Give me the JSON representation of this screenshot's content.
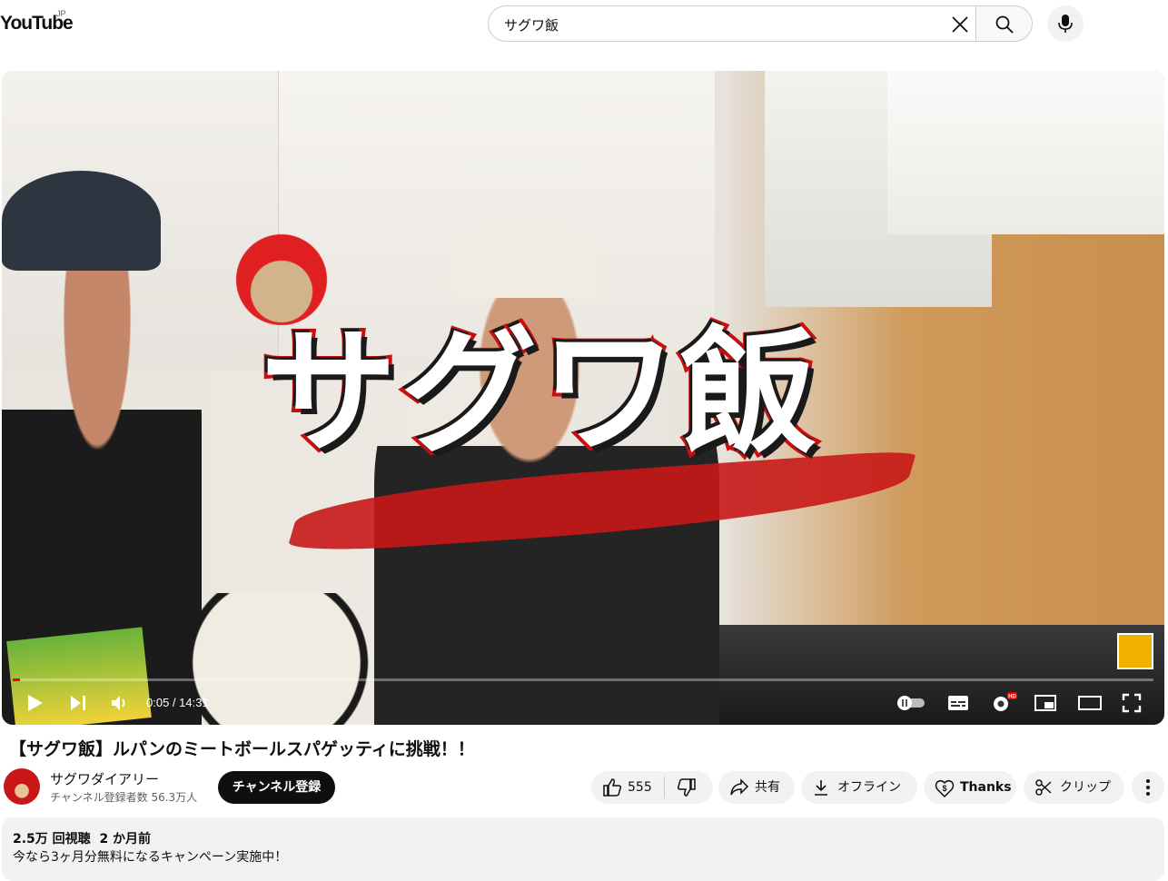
{
  "header": {
    "logo": "YouTube",
    "region": "JP",
    "search_value": "サグワ飯"
  },
  "player": {
    "overlay_title": "サグワ飯",
    "time": "0:05 / 14:31",
    "progress_fraction": 0.006
  },
  "video": {
    "title": "【サグワ飯】ルパンのミートボールスパゲッティに挑戦！！",
    "channel_name": "サグワダイアリー",
    "subscribers": "チャンネル登録者数 56.3万人",
    "subscribe_label": "チャンネル登録",
    "like_count": "555",
    "share_label": "共有",
    "offline_label": "オフライン",
    "thanks_label": "Thanks",
    "clip_label": "クリップ"
  },
  "description": {
    "views": "2.5万 回視聴",
    "age": "2 か月前",
    "text": "今なら3ヶ月分無料になるキャンペーン実施中！"
  },
  "colors": {
    "brand_red": "#ff0000",
    "subscribe_bg": "#0f0f0f",
    "pill_bg": "#f2f2f2"
  }
}
